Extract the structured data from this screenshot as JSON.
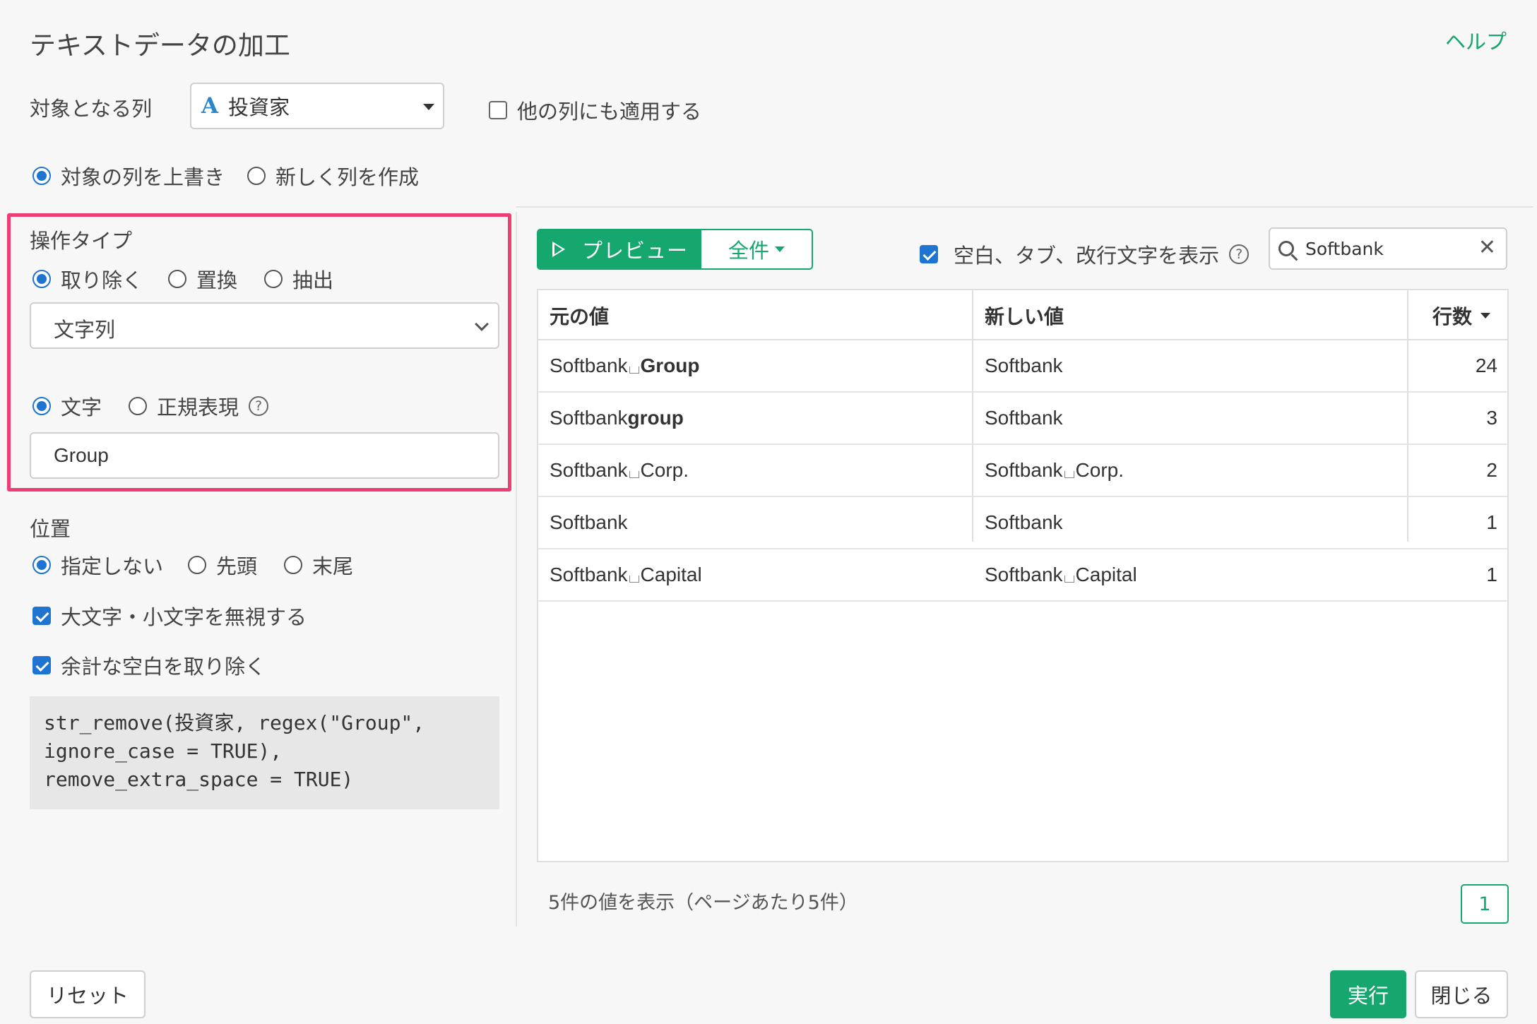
{
  "dialog": {
    "title": "テキストデータの加工",
    "help_label": "ヘルプ"
  },
  "target": {
    "label": "対象となる列",
    "column_type_symbol": "A",
    "column_value": "投資家",
    "apply_other_label": "他の列にも適用する",
    "apply_other_checked": false
  },
  "output_mode": {
    "options": [
      "対象の列を上書き",
      "新しく列を作成"
    ],
    "selected": "対象の列を上書き"
  },
  "operation": {
    "label": "操作タイプ",
    "options": [
      "取り除く",
      "置換",
      "抽出"
    ],
    "selected": "取り除く",
    "target_type": "文字列",
    "match_options": [
      "文字",
      "正規表現"
    ],
    "match_selected": "文字",
    "pattern_value": "Group"
  },
  "position": {
    "label": "位置",
    "options": [
      "指定しない",
      "先頭",
      "末尾"
    ],
    "selected": "指定しない"
  },
  "flags": {
    "ignore_case_label": "大文字・小文字を無視する",
    "ignore_case_checked": true,
    "remove_space_label": "余計な空白を取り除く",
    "remove_space_checked": true
  },
  "code_preview": "str_remove(投資家, regex(\"Group\",\nignore_case = TRUE),\nremove_extra_space = TRUE)",
  "preview": {
    "preview_button": "プレビュー",
    "all_button": "全件",
    "show_whitespace_label": "空白、タブ、改行文字を表示",
    "show_whitespace_checked": true,
    "search_value": "Softbank",
    "columns": [
      "元の値",
      "新しい値",
      "行数"
    ],
    "rows": [
      {
        "orig_a": "Softbank",
        "orig_space": true,
        "orig_b": "Group",
        "orig_b_bold": true,
        "new_a": "Softbank",
        "new_space": false,
        "new_b": "",
        "count": "24"
      },
      {
        "orig_a": "Softbank",
        "orig_space": false,
        "orig_b": "group",
        "orig_b_bold": true,
        "new_a": "Softbank",
        "new_space": false,
        "new_b": "",
        "count": "3"
      },
      {
        "orig_a": "Softbank",
        "orig_space": true,
        "orig_b": "Corp.",
        "orig_b_bold": false,
        "new_a": "Softbank",
        "new_space": true,
        "new_b": "Corp.",
        "count": "2"
      },
      {
        "orig_a": "Softbank",
        "orig_space": false,
        "orig_b": "",
        "orig_b_bold": false,
        "new_a": "Softbank",
        "new_space": false,
        "new_b": "",
        "count": "1"
      },
      {
        "orig_a": "Softbank",
        "orig_space": true,
        "orig_b": "Capital",
        "orig_b_bold": false,
        "new_a": "Softbank",
        "new_space": true,
        "new_b": "Capital",
        "count": "1"
      }
    ],
    "footer_text": "5件の値を表示（ページあたり5件）",
    "current_page": "1"
  },
  "actions": {
    "reset_label": "リセット",
    "run_label": "実行",
    "close_label": "閉じる"
  },
  "colors": {
    "accent_green": "#15a76d",
    "check_blue": "#1f74d2",
    "highlight_pink": "#ec3d74"
  }
}
